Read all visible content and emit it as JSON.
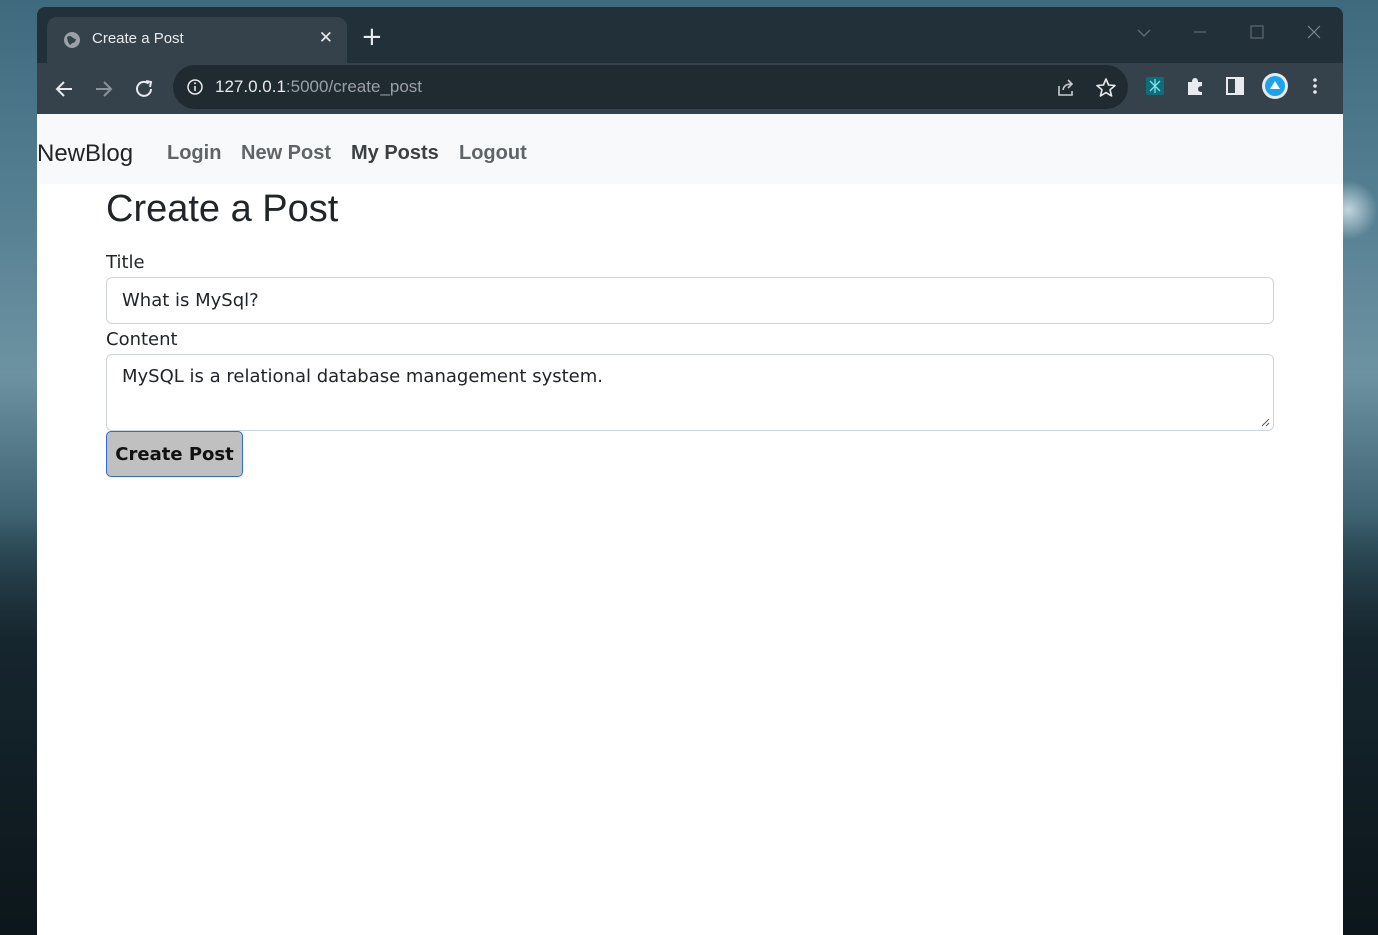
{
  "browser": {
    "tab_title": "Create a Post",
    "url_host": "127.0.0.1",
    "url_rest": ":5000/create_post"
  },
  "navbar": {
    "brand": "NewBlog",
    "links": [
      "Login",
      "New Post",
      "My Posts",
      "Logout"
    ]
  },
  "form": {
    "heading": "Create a Post",
    "title_label": "Title",
    "title_value": "What is MySql?",
    "content_label": "Content",
    "content_value": "MySQL is a relational database management system.",
    "submit_label": "Create Post"
  },
  "colors": {
    "chrome_dark": "#1f2a31",
    "chrome_toolbar": "#35424c",
    "navbar_bg": "#f8f9fa",
    "button_bg": "#c0c0c0",
    "button_border": "#2f6bd6"
  }
}
